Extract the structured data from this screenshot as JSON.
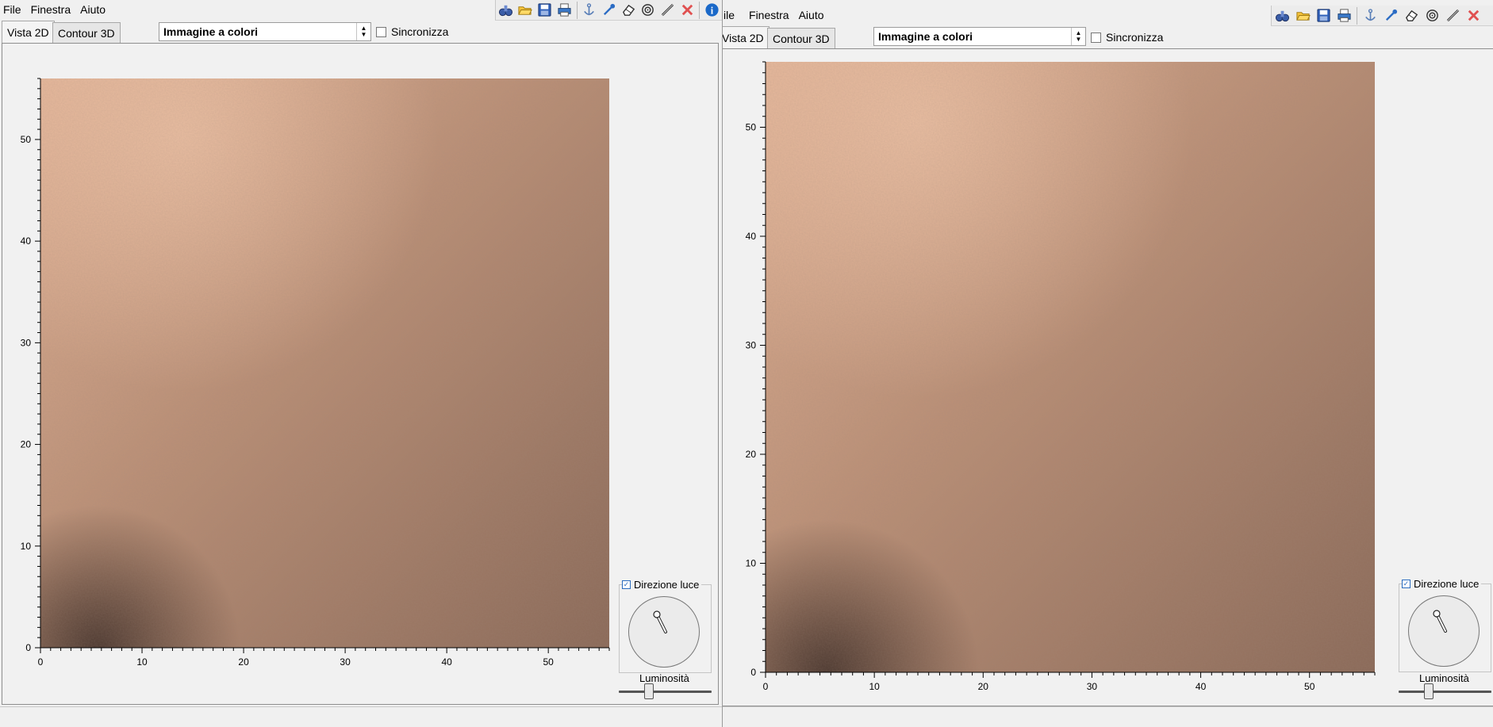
{
  "colors": {
    "skin_light": "#e2b295",
    "skin_mid": "#b98e75",
    "skin_dark": "#8a6958",
    "window_bg": "#f0f0f0",
    "info_blue": "#1a68c8",
    "close_red": "#e05050"
  },
  "left": {
    "menu": {
      "file": "File",
      "window": "Finestra",
      "help": "Aiuto"
    },
    "toolbar_icons": [
      "binoculars-icon",
      "folder-open-icon",
      "save-icon",
      "print-icon",
      "anchor-icon",
      "pipette-icon",
      "eraser-icon",
      "target-icon",
      "ruler-icon",
      "close-icon",
      "info-icon"
    ],
    "tabs": [
      "Vista 2D",
      "Contour 3D"
    ],
    "select_value": "Immagine a colori",
    "sync_label": "Sincronizza",
    "light_direction_label": "Direzione luce",
    "brightness_label": "Luminosità",
    "brightness": 0.3,
    "x_ticks": [
      "0",
      "10",
      "20",
      "30",
      "40",
      "50"
    ],
    "y_ticks": [
      "0",
      "10",
      "20",
      "30",
      "40",
      "50"
    ]
  },
  "right": {
    "menu": {
      "file": "ile",
      "window": "Finestra",
      "help": "Aiuto"
    },
    "toolbar_icons": [
      "binoculars-icon",
      "folder-open-icon",
      "save-icon",
      "print-icon",
      "anchor-icon",
      "pipette-icon",
      "eraser-icon",
      "target-icon",
      "ruler-icon",
      "close-icon"
    ],
    "tabs": [
      "Vista 2D",
      "Contour 3D"
    ],
    "select_value": "Immagine a colori",
    "sync_label": "Sincronizza",
    "light_direction_label": "Direzione luce",
    "brightness_label": "Luminosità",
    "brightness": 0.3,
    "x_ticks": [
      "0",
      "10",
      "20",
      "30",
      "40",
      "50"
    ],
    "y_ticks": [
      "0",
      "10",
      "20",
      "30",
      "40",
      "50"
    ]
  }
}
